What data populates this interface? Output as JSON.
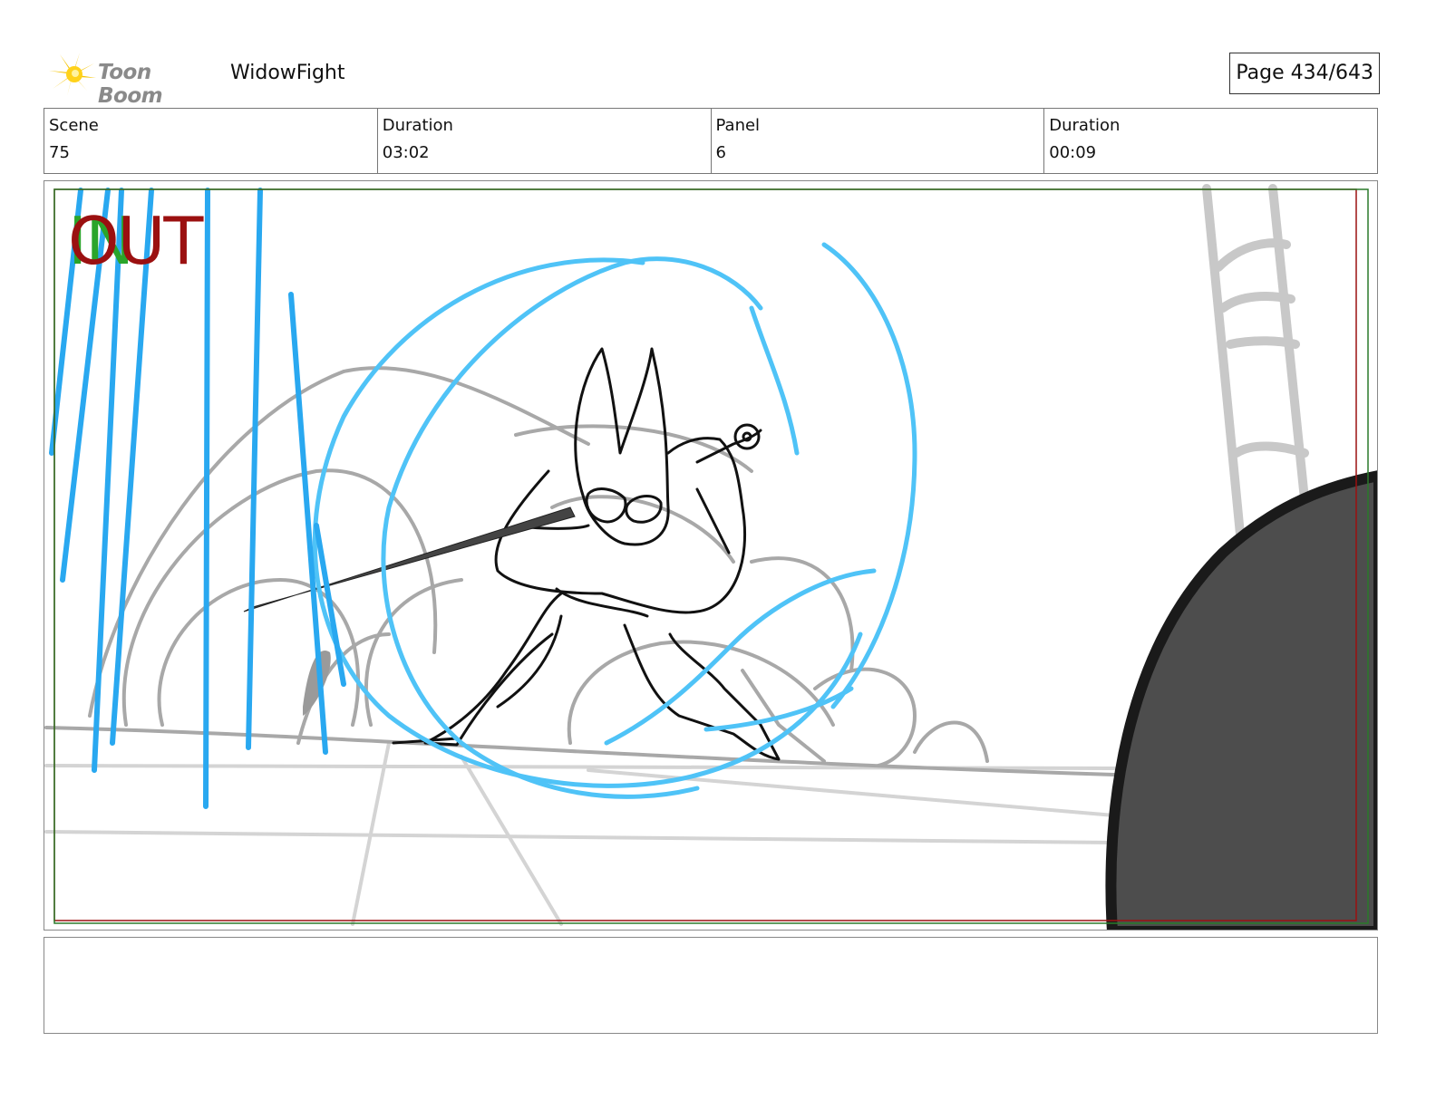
{
  "header": {
    "logo_text": "Toon Boom",
    "project_name": "WidowFight",
    "page_label": "Page 434/643"
  },
  "info": {
    "scene_label": "Scene",
    "scene_value": "75",
    "scene_duration_label": "Duration",
    "scene_duration_value": "03:02",
    "panel_label": "Panel",
    "panel_value": "6",
    "panel_duration_label": "Duration",
    "panel_duration_value": "00:09"
  },
  "panel_image": {
    "marker_in": "IN",
    "marker_out": "OUT",
    "colors": {
      "effect_lines": "#4fc3f7",
      "character_lines": "#111111",
      "background_sketch": "#a0a0a0",
      "foreground_shape": "#4d4d4d",
      "frame_red": "#9b1010",
      "frame_green": "#2a7a2a"
    }
  },
  "notes": {
    "text": ""
  }
}
